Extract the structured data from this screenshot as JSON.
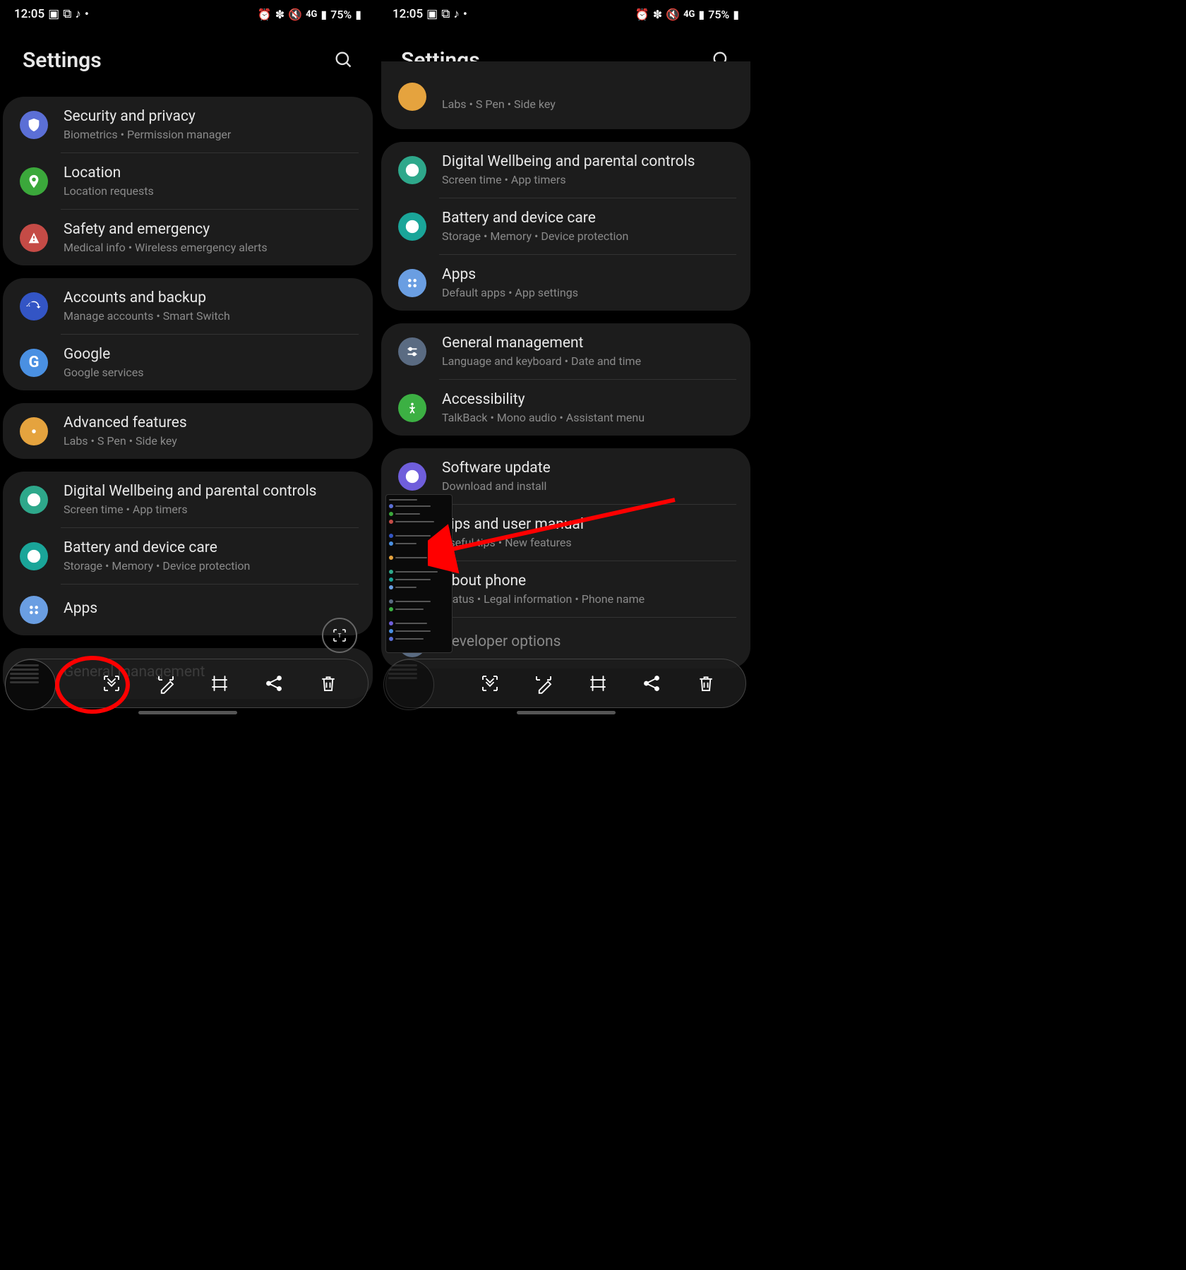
{
  "status": {
    "time": "12:05",
    "battery": "75%",
    "network": "4G"
  },
  "header": {
    "title": "Settings"
  },
  "left": {
    "groups": [
      {
        "items": [
          {
            "title": "Security and privacy",
            "sub": "Biometrics  •  Permission manager",
            "iconClass": "ic-blue",
            "icon": "shield"
          },
          {
            "title": "Location",
            "sub": "Location requests",
            "iconClass": "ic-green",
            "icon": "pin"
          },
          {
            "title": "Safety and emergency",
            "sub": "Medical info  •  Wireless emergency alerts",
            "iconClass": "ic-red",
            "icon": "alert"
          }
        ]
      },
      {
        "items": [
          {
            "title": "Accounts and backup",
            "sub": "Manage accounts  •  Smart Switch",
            "iconClass": "ic-dblue",
            "icon": "refresh"
          },
          {
            "title": "Google",
            "sub": "Google services",
            "iconClass": "ic-lblue",
            "icon": "google"
          }
        ]
      },
      {
        "items": [
          {
            "title": "Advanced features",
            "sub": "Labs  •  S Pen  •  Side key",
            "iconClass": "ic-orange",
            "icon": "gear-plus"
          }
        ]
      },
      {
        "items": [
          {
            "title": "Digital Wellbeing and parental controls",
            "sub": "Screen time  •  App timers",
            "iconClass": "ic-teal",
            "icon": "heart"
          },
          {
            "title": "Battery and device care",
            "sub": "Storage  •  Memory  •  Device protection",
            "iconClass": "ic-teal2",
            "icon": "care"
          },
          {
            "title": "Apps",
            "sub": "",
            "iconClass": "ic-bluelight",
            "icon": "apps"
          }
        ]
      },
      {
        "items": [
          {
            "title": "General management",
            "sub": "",
            "iconClass": "ic-grayblue",
            "icon": "sliders"
          }
        ]
      }
    ]
  },
  "right": {
    "partial": {
      "sub": "Labs  •  S Pen  •  Side key",
      "iconClass": "ic-orange"
    },
    "groups": [
      {
        "items": [
          {
            "title": "Digital Wellbeing and parental controls",
            "sub": "Screen time  •  App timers",
            "iconClass": "ic-teal",
            "icon": "heart"
          },
          {
            "title": "Battery and device care",
            "sub": "Storage  •  Memory  •  Device protection",
            "iconClass": "ic-teal2",
            "icon": "care"
          },
          {
            "title": "Apps",
            "sub": "Default apps  •  App settings",
            "iconClass": "ic-bluelight",
            "icon": "apps"
          }
        ]
      },
      {
        "items": [
          {
            "title": "General management",
            "sub": "Language and keyboard  •  Date and time",
            "iconClass": "ic-grayblue",
            "icon": "sliders"
          },
          {
            "title": "Accessibility",
            "sub": "TalkBack  •  Mono audio  •  Assistant menu",
            "iconClass": "ic-greenbright",
            "icon": "person"
          }
        ]
      },
      {
        "items": [
          {
            "title": "Software update",
            "sub": "Download and install",
            "iconClass": "ic-purple",
            "icon": "download"
          },
          {
            "title": "Tips and user manual",
            "sub": "Useful tips  •  New features",
            "iconClass": "ic-lblue",
            "icon": "qmark"
          },
          {
            "title": "About phone",
            "sub": "Status  •  Legal information  •  Phone name",
            "iconClass": "ic-blue",
            "icon": "info"
          },
          {
            "title": "Developer options",
            "sub": "",
            "iconClass": "ic-grayblue",
            "icon": "braces"
          }
        ]
      }
    ]
  }
}
